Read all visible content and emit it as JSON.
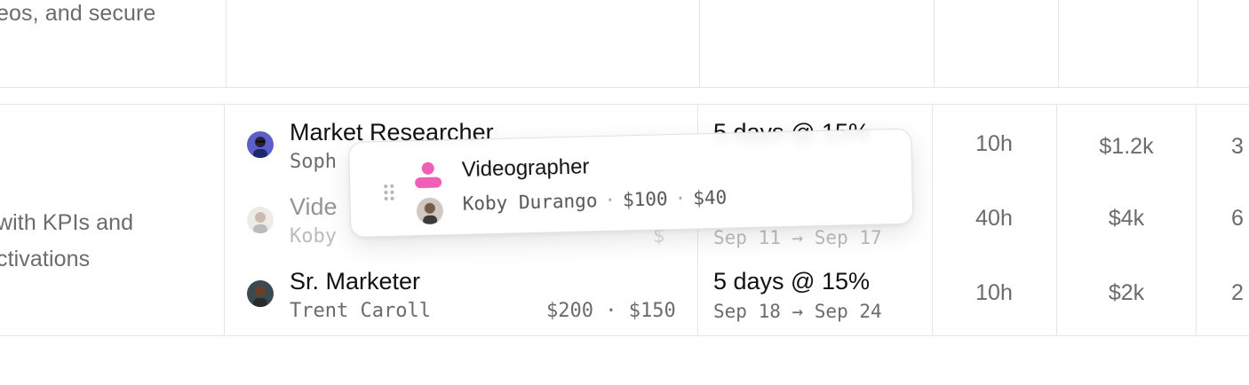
{
  "colors": {
    "grid": "#e6e6e6",
    "muted_text": "#6b6b6b",
    "primary_text": "#111111",
    "role_icon": "#ee5fb5"
  },
  "top_row": {
    "description": "eos, and secure"
  },
  "group": {
    "description_lines": [
      "with KPIs and",
      "ctivations"
    ]
  },
  "rows": [
    {
      "role": "Market Researcher",
      "person": "Soph",
      "schedule": "5 days @ 15%",
      "hours": "10h",
      "cost": "$1.2k",
      "extra": "3"
    },
    {
      "role": "Vide",
      "person": "Koby",
      "rate_partial": "$",
      "dates": "Sep 11 → Sep 17",
      "hours": "40h",
      "cost": "$4k",
      "extra": "6"
    },
    {
      "role": "Sr. Marketer",
      "person": "Trent Caroll",
      "rates": "$200 · $150",
      "schedule": "5 days @ 15%",
      "dates": "Sep 18 → Sep 24",
      "hours": "10h",
      "cost": "$2k",
      "extra": "2"
    }
  ],
  "drag_card": {
    "role_icon": "person-icon",
    "handle_icon": "drag-handle-icon",
    "title": "Videographer",
    "person": "Koby Durango",
    "rate_a": "$100",
    "rate_b": "$40",
    "separator": "·"
  }
}
